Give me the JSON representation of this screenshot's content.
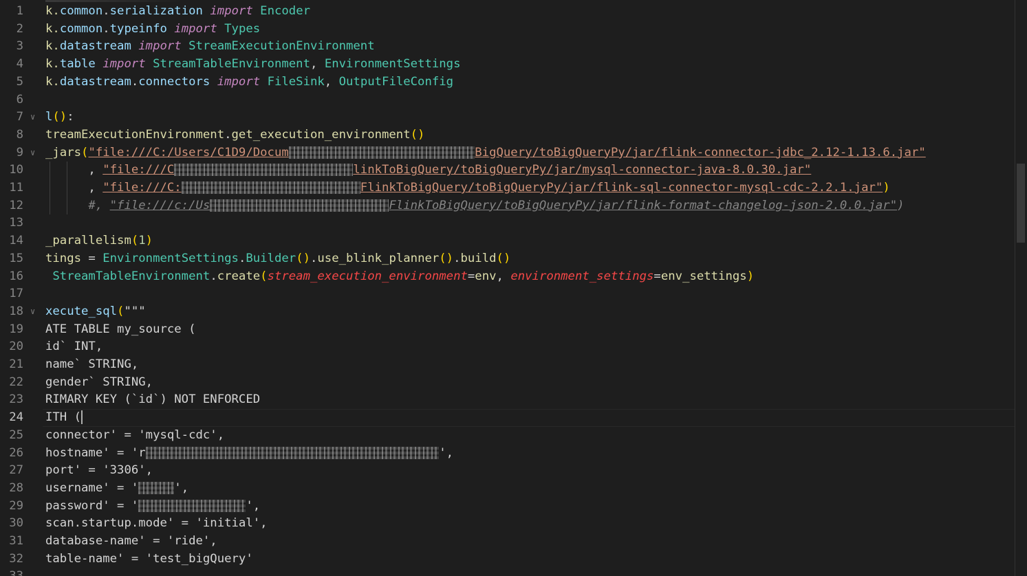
{
  "editor": {
    "active_line": "24",
    "lines": [
      {
        "n": "1",
        "segs": [
          [
            "y",
            "k."
          ],
          [
            "b",
            "common"
          ],
          [
            "o",
            "."
          ],
          [
            "b",
            "serialization"
          ],
          [
            "o",
            " "
          ],
          [
            "k",
            "import"
          ],
          [
            "o",
            " "
          ],
          [
            "t",
            "Encoder"
          ]
        ]
      },
      {
        "n": "2",
        "segs": [
          [
            "y",
            "k."
          ],
          [
            "b",
            "common"
          ],
          [
            "o",
            "."
          ],
          [
            "b",
            "typeinfo"
          ],
          [
            "o",
            " "
          ],
          [
            "k",
            "import"
          ],
          [
            "o",
            " "
          ],
          [
            "t",
            "Types"
          ]
        ]
      },
      {
        "n": "3",
        "segs": [
          [
            "y",
            "k."
          ],
          [
            "b",
            "datastream"
          ],
          [
            "o",
            " "
          ],
          [
            "k",
            "import"
          ],
          [
            "o",
            " "
          ],
          [
            "t",
            "StreamExecutionEnvironment"
          ]
        ]
      },
      {
        "n": "4",
        "segs": [
          [
            "y",
            "k."
          ],
          [
            "b",
            "table"
          ],
          [
            "o",
            " "
          ],
          [
            "k",
            "import"
          ],
          [
            "o",
            " "
          ],
          [
            "t",
            "StreamTableEnvironment"
          ],
          [
            "o",
            ", "
          ],
          [
            "t",
            "EnvironmentSettings"
          ]
        ]
      },
      {
        "n": "5",
        "segs": [
          [
            "y",
            "k."
          ],
          [
            "b",
            "datastream"
          ],
          [
            "o",
            "."
          ],
          [
            "b",
            "connectors"
          ],
          [
            "o",
            " "
          ],
          [
            "k",
            "import"
          ],
          [
            "o",
            " "
          ],
          [
            "t",
            "FileSink"
          ],
          [
            "o",
            ", "
          ],
          [
            "t",
            "OutputFileConfig"
          ]
        ]
      },
      {
        "n": "6",
        "segs": []
      },
      {
        "n": "7",
        "segs": [
          [
            "b",
            "l"
          ],
          [
            "p",
            "()"
          ],
          [
            "o",
            ":"
          ]
        ]
      },
      {
        "n": "8",
        "segs": [
          [
            "y",
            "treamExecutionEnvironment"
          ],
          [
            "o",
            "."
          ],
          [
            "y",
            "get_execution_environment"
          ],
          [
            "p",
            "()"
          ]
        ]
      },
      {
        "n": "9",
        "segs": [
          [
            "y",
            "_jars"
          ],
          [
            "p",
            "("
          ],
          [
            "u",
            "\"file:///C:/Users/C1D9/Docum"
          ],
          [
            "blur",
            "                          "
          ],
          [
            "u",
            "BigQuery/toBigQueryPy/jar/flink-connector-jdbc_2.12-1.13.6.jar\""
          ]
        ]
      },
      {
        "n": "10",
        "segs": [
          [
            "o",
            "      , "
          ],
          [
            "u",
            "\"file:///C"
          ],
          [
            "blur",
            "                         "
          ],
          [
            "u",
            "linkToBigQuery/toBigQueryPy/jar/mysql-connector-java-8.0.30.jar\""
          ]
        ]
      },
      {
        "n": "11",
        "segs": [
          [
            "o",
            "      , "
          ],
          [
            "u",
            "\"file:///C:"
          ],
          [
            "blur",
            "                         "
          ],
          [
            "u",
            "FlinkToBigQuery/toBigQueryPy/jar/flink-sql-connector-mysql-cdc-2.2.1.jar\""
          ],
          [
            "p",
            ")"
          ]
        ]
      },
      {
        "n": "12",
        "segs": [
          [
            "cg",
            "      #, "
          ],
          [
            "cgu",
            "\"file:///c:/Us"
          ],
          [
            "blur",
            "                         "
          ],
          [
            "cgu",
            "FlinkToBigQuery/toBigQueryPy/jar/flink-format-changelog-json-2.0.0.jar\""
          ],
          [
            "cg",
            ")"
          ]
        ]
      },
      {
        "n": "13",
        "segs": []
      },
      {
        "n": "14",
        "segs": [
          [
            "y",
            "_parallelism"
          ],
          [
            "p",
            "("
          ],
          [
            "n",
            "1"
          ],
          [
            "p",
            ")"
          ]
        ]
      },
      {
        "n": "15",
        "segs": [
          [
            "y",
            "tings"
          ],
          [
            "o",
            " = "
          ],
          [
            "t",
            "EnvironmentSettings"
          ],
          [
            "o",
            "."
          ],
          [
            "t",
            "Builder"
          ],
          [
            "p",
            "()"
          ],
          [
            "o",
            "."
          ],
          [
            "y",
            "use_blink_planner"
          ],
          [
            "p",
            "()"
          ],
          [
            "o",
            "."
          ],
          [
            "y",
            "build"
          ],
          [
            "p",
            "()"
          ]
        ]
      },
      {
        "n": "16",
        "segs": [
          [
            "o",
            " "
          ],
          [
            "t",
            "StreamTableEnvironment"
          ],
          [
            "o",
            "."
          ],
          [
            "y",
            "create"
          ],
          [
            "p",
            "("
          ],
          [
            "r",
            "stream_execution_environment"
          ],
          [
            "o",
            "="
          ],
          [
            "y",
            "env"
          ],
          [
            "o",
            ", "
          ],
          [
            "r",
            "environment_settings"
          ],
          [
            "o",
            "="
          ],
          [
            "y",
            "env_settings"
          ],
          [
            "p",
            ")"
          ]
        ]
      },
      {
        "n": "17",
        "segs": []
      },
      {
        "n": "18",
        "segs": [
          [
            "b",
            "xecute_sql"
          ],
          [
            "p",
            "("
          ],
          [
            "w",
            "\"\"\""
          ]
        ]
      },
      {
        "n": "19",
        "segs": [
          [
            "w",
            "ATE TABLE my_source ("
          ]
        ]
      },
      {
        "n": "20",
        "segs": [
          [
            "w",
            "id` INT,"
          ]
        ]
      },
      {
        "n": "21",
        "segs": [
          [
            "w",
            "name` STRING,"
          ]
        ]
      },
      {
        "n": "22",
        "segs": [
          [
            "w",
            "gender` STRING,"
          ]
        ]
      },
      {
        "n": "23",
        "segs": [
          [
            "w",
            "RIMARY KEY (`id`) NOT ENFORCED"
          ]
        ]
      },
      {
        "n": "24",
        "segs": [
          [
            "w",
            "ITH ("
          ],
          [
            "cursor",
            ""
          ]
        ]
      },
      {
        "n": "25",
        "segs": [
          [
            "w",
            "connector' = 'mysql-cdc',"
          ]
        ]
      },
      {
        "n": "26",
        "segs": [
          [
            "w",
            "hostname' = 'r"
          ],
          [
            "blur",
            "                                         "
          ],
          [
            "w",
            "',"
          ]
        ]
      },
      {
        "n": "27",
        "segs": [
          [
            "w",
            "port' = '3306',"
          ]
        ]
      },
      {
        "n": "28",
        "segs": [
          [
            "w",
            "username' = '"
          ],
          [
            "blur",
            "     "
          ],
          [
            "w",
            "',"
          ]
        ]
      },
      {
        "n": "29",
        "segs": [
          [
            "w",
            "password' = '"
          ],
          [
            "blur",
            "               "
          ],
          [
            "w",
            "',"
          ]
        ]
      },
      {
        "n": "30",
        "segs": [
          [
            "w",
            "scan.startup.mode' = 'initial',"
          ]
        ]
      },
      {
        "n": "31",
        "segs": [
          [
            "w",
            "database-name' = 'ride',"
          ]
        ]
      },
      {
        "n": "32",
        "segs": [
          [
            "w",
            "table-name' = 'test_bigQuery'"
          ]
        ]
      },
      {
        "n": "33",
        "segs": []
      }
    ],
    "fold_lines": [
      "7",
      "9",
      "18"
    ],
    "fold_icon": "chevron-down-icon"
  },
  "colors": {
    "background": "#1e1e1e",
    "line_number": "#858585",
    "function": "#dcdcaa",
    "variable": "#9cdcfe",
    "keyword": "#c586c0",
    "string": "#ce9178",
    "class": "#4ec9b0",
    "bracket": "#ffd700",
    "param": "#f44747"
  }
}
